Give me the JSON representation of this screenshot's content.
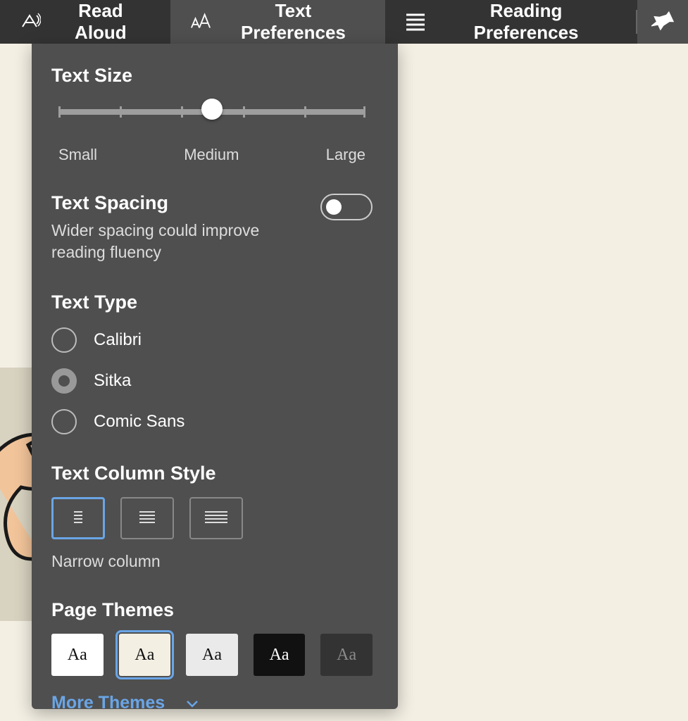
{
  "toolbar": {
    "tabs": [
      {
        "label": "Read Aloud",
        "icon": "read-aloud-icon"
      },
      {
        "label": "Text Preferences",
        "icon": "text-size-icon"
      },
      {
        "label": "Reading Preferences",
        "icon": "lines-icon"
      }
    ],
    "active_tab": 1,
    "pin_icon": "pin-icon"
  },
  "panel": {
    "text_size": {
      "title": "Text Size",
      "labels": {
        "small": "Small",
        "medium": "Medium",
        "large": "Large"
      },
      "value": "Medium"
    },
    "text_spacing": {
      "title": "Text Spacing",
      "description": "Wider spacing could improve reading fluency",
      "enabled": false
    },
    "text_type": {
      "title": "Text Type",
      "options": [
        "Calibri",
        "Sitka",
        "Comic Sans"
      ],
      "selected": "Sitka"
    },
    "column_style": {
      "title": "Text Column Style",
      "options": [
        "narrow",
        "medium",
        "wide"
      ],
      "selected": "narrow",
      "caption": "Narrow column"
    },
    "page_themes": {
      "title": "Page Themes",
      "themes": [
        {
          "swatch": "Aa",
          "bg": "#ffffff",
          "fg": "#111111"
        },
        {
          "swatch": "Aa",
          "bg": "#f3efe3",
          "fg": "#111111"
        },
        {
          "swatch": "Aa",
          "bg": "#eaeaea",
          "fg": "#111111"
        },
        {
          "swatch": "Aa",
          "bg": "#111111",
          "fg": "#ffffff"
        },
        {
          "swatch": "Aa",
          "bg": "#333333",
          "fg": "#8a8a8a"
        }
      ],
      "selected_index": 1,
      "more_link": "More Themes"
    }
  }
}
